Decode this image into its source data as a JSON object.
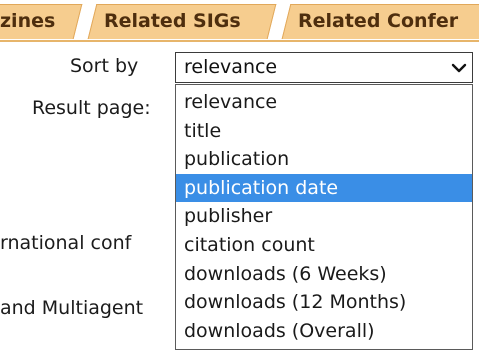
{
  "tabs": [
    {
      "label": "zines"
    },
    {
      "label": "Related SIGs"
    },
    {
      "label": "Related Confer"
    }
  ],
  "sort": {
    "label": "Sort by",
    "value": "relevance",
    "options": [
      {
        "label": "relevance"
      },
      {
        "label": "title"
      },
      {
        "label": "publication"
      },
      {
        "label": "publication date",
        "highlighted": true
      },
      {
        "label": "publisher"
      },
      {
        "label": "citation count"
      },
      {
        "label": "downloads (6 Weeks)"
      },
      {
        "label": "downloads (12 Months)"
      },
      {
        "label": "downloads (Overall)"
      }
    ]
  },
  "result_page": {
    "label": "Result page:"
  },
  "background_text": {
    "line1": "rnational conf",
    "line2": "and Multiagent"
  },
  "colors": {
    "tab_background": "#f6cd8f",
    "tab_text": "#4e2e0e",
    "highlight": "#3a8ee6"
  },
  "icons": {
    "select_arrow": "chevron-down-icon"
  }
}
